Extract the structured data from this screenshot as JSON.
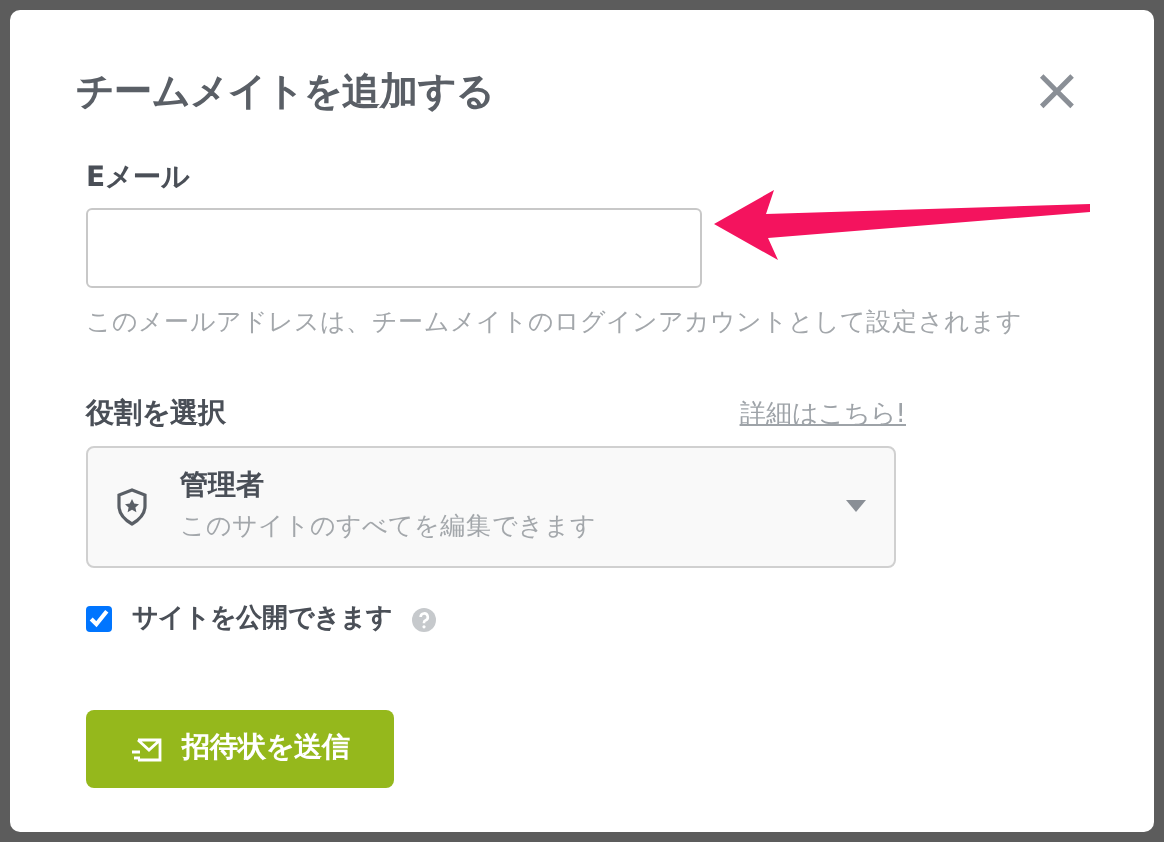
{
  "dialog": {
    "title": "チームメイトを追加する",
    "close": "×"
  },
  "email": {
    "label": "Eメール",
    "hint": "このメールアドレスは、チームメイトのログインアカウントとして設定されます"
  },
  "role": {
    "label": "役割を選択",
    "link": "詳細はこちら!",
    "selected_name": "管理者",
    "selected_description": "このサイトのすべてを編集できます"
  },
  "publish": {
    "label": "サイトを公開できます",
    "checked": true
  },
  "submit": {
    "label": "招待状を送信"
  }
}
